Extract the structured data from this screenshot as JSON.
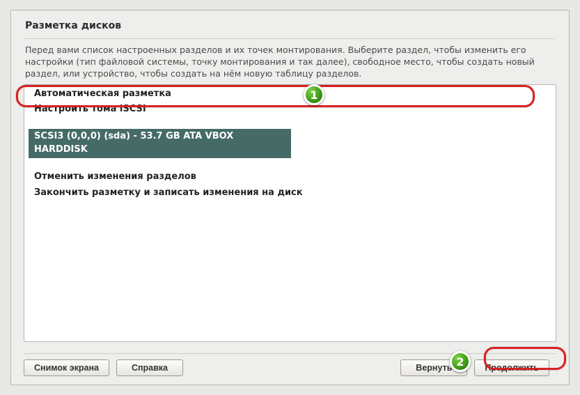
{
  "window": {
    "title": "Разметка дисков",
    "instructions": "Перед вами список настроенных разделов и их точек монтирования. Выберите раздел, чтобы изменить его настройки (тип файловой системы, точку монтирования и так далее), свободное место, чтобы создать новый раздел, или устройство, чтобы создать на нём новую таблицу разделов."
  },
  "list": {
    "items": [
      {
        "label": "Автоматическая разметка",
        "selected": false
      },
      {
        "label": "Настроить тома iSCSI",
        "selected": false
      },
      {
        "label": "SCSI3 (0,0,0) (sda) - 53.7 GB ATA VBOX HARDDISK",
        "selected": true
      },
      {
        "label": "Отменить изменения разделов",
        "selected": false
      },
      {
        "label": "Закончить разметку и записать изменения на диск",
        "selected": false
      }
    ]
  },
  "buttons": {
    "screenshot": "Снимок экрана",
    "help": "Справка",
    "back": "Вернуть",
    "continue": "Продолжить"
  },
  "annotations": {
    "badge1": "1",
    "badge2": "2"
  }
}
